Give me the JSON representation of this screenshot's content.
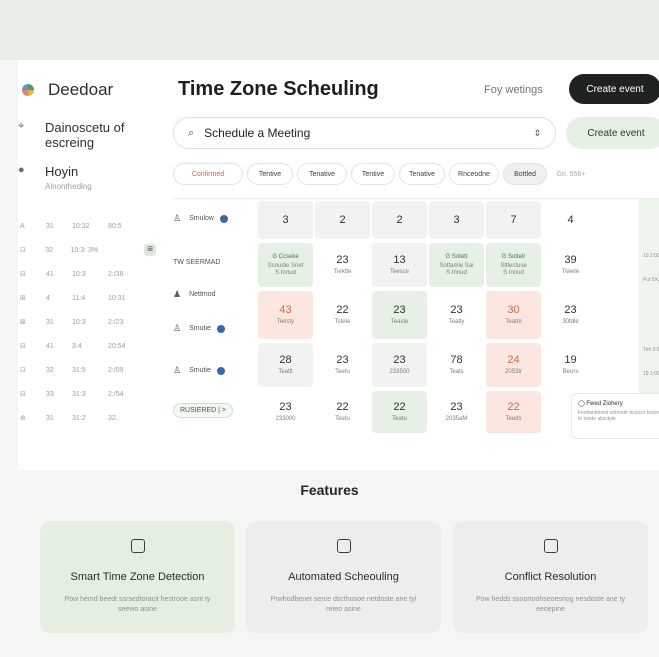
{
  "app": {
    "name": "Deedoar",
    "title": "Time Zone Scheuling",
    "my_meetings": "Foy wetings",
    "create_event_top": "Create event"
  },
  "sidebar": {
    "items": [
      {
        "icon": "pin-icon",
        "label": "Dainoscetu of escreing"
      },
      {
        "icon": "circle-icon",
        "label": "Hoyin"
      }
    ],
    "subtitle": "Alnontheding",
    "rows": [
      [
        "A",
        "31",
        "10:32",
        "80:5"
      ],
      [
        "⊡",
        "32",
        "10:3: 3%",
        ""
      ],
      [
        "⊟",
        "41",
        "10:3",
        "2:/38"
      ],
      [
        "⊞",
        "4",
        "11:4",
        "10:31"
      ],
      [
        "⊠",
        "31",
        "10:3",
        "2:/23"
      ],
      [
        "⊟",
        "41",
        "3:4",
        "20:54"
      ],
      [
        "⊡",
        "32",
        "31:5",
        "2:/09"
      ],
      [
        "⊟",
        "33",
        "31:3",
        "2:/54"
      ],
      [
        "⊕",
        "31",
        "31:2",
        "32."
      ]
    ]
  },
  "search": {
    "value": "Schedule a Meeting",
    "icon": "search-icon"
  },
  "create_event_secondary": "Create event",
  "filters": [
    "Confirmed",
    "Tentive",
    "Tenative",
    "Tentive",
    "Tenative",
    "Rnceodne",
    "Bottled",
    "Gri. 556+"
  ],
  "rows": [
    {
      "label": "Smulow",
      "icon": "user-icon"
    },
    {
      "label": "TW SEERMAD",
      "icon": "clock-icon"
    },
    {
      "label": "Nettmod",
      "icon": "people-icon"
    },
    {
      "label": "Smutie",
      "icon": "user-icon"
    },
    {
      "label": "Smutie",
      "icon": "user-icon"
    },
    {
      "label": "RUSIERED | >",
      "icon": ""
    }
  ],
  "grid": {
    "header": [
      "3",
      "2",
      "2",
      "3",
      "7",
      "4"
    ],
    "row2": [
      {
        "num": "G Ccseke",
        "sub": "Ssoudie Snet\nS Innud",
        "tone": "green"
      },
      {
        "num": "23",
        "sub": "Tiektte",
        "tone": "white"
      },
      {
        "num": "13",
        "sub": "Teesce",
        "tone": "gray"
      },
      {
        "num": "G Sotett",
        "sub": "Sottamle Sai\nS Innud",
        "tone": "green"
      },
      {
        "num": "G Sottelr",
        "sub": "Sttlectuse\nS Innud",
        "tone": "green"
      },
      {
        "num": "39",
        "sub": "Tiwete",
        "tone": "white"
      }
    ],
    "row3": [
      {
        "num": "43",
        "sub": "Teesty",
        "tone": "peach"
      },
      {
        "num": "22",
        "sub": "Tstete",
        "tone": "white"
      },
      {
        "num": "23",
        "sub": "Teasle",
        "tone": "green"
      },
      {
        "num": "23",
        "sub": "Teatly",
        "tone": "white"
      },
      {
        "num": "30",
        "sub": "Teatm",
        "tone": "peach"
      },
      {
        "num": "23",
        "sub": "30tdle",
        "tone": "white"
      }
    ],
    "row4": [
      {
        "num": "28",
        "sub": "Teatlt",
        "tone": "gray"
      },
      {
        "num": "23",
        "sub": "Teetu",
        "tone": "white"
      },
      {
        "num": "23",
        "sub": "233500",
        "tone": "gray"
      },
      {
        "num": "78",
        "sub": "Teats",
        "tone": "white"
      },
      {
        "num": "24",
        "sub": "2053tr",
        "tone": "peach"
      },
      {
        "num": "19",
        "sub": "Beurs",
        "tone": "white"
      }
    ],
    "row5": [
      {
        "num": "23",
        "sub": "233000",
        "tone": "white"
      },
      {
        "num": "22",
        "sub": "Teetu",
        "tone": "white"
      },
      {
        "num": "22",
        "sub": "Teatu",
        "tone": "green"
      },
      {
        "num": "23",
        "sub": "2035aM",
        "tone": "white"
      },
      {
        "num": "22",
        "sub": "Teeds",
        "tone": "peach"
      }
    ]
  },
  "side_panel": {
    "entries": [
      "10 2:00",
      "Fur 5Xzine",
      "Tim 3-800",
      "19 1:00"
    ]
  },
  "note_card": {
    "title": "Fwed Ziohery",
    "desc": "Festtantdonol sdrmodr fecticsr bsdom to toede aksctple"
  },
  "features": {
    "title": "Features",
    "cards": [
      {
        "icon": "phone-icon",
        "title": "Smart Time Zone Detection",
        "desc": "Pow hemd beedt ssrsedtoracit hestrooe asnt ty seewo asine",
        "bg": "#e4efe2"
      },
      {
        "icon": "calendar-icon",
        "title": "Automated Scheouling",
        "desc": "Prwhodbenet serce dscthosoe netdoste ane tyi reteo asine",
        "bg": "#eceeec"
      },
      {
        "icon": "bag-icon",
        "title": "Conflict Resolution",
        "desc": "Pow hedds ssoortoohseoesriog nesdoste ane ty eeoepine",
        "bg": "#eceeec"
      }
    ]
  }
}
